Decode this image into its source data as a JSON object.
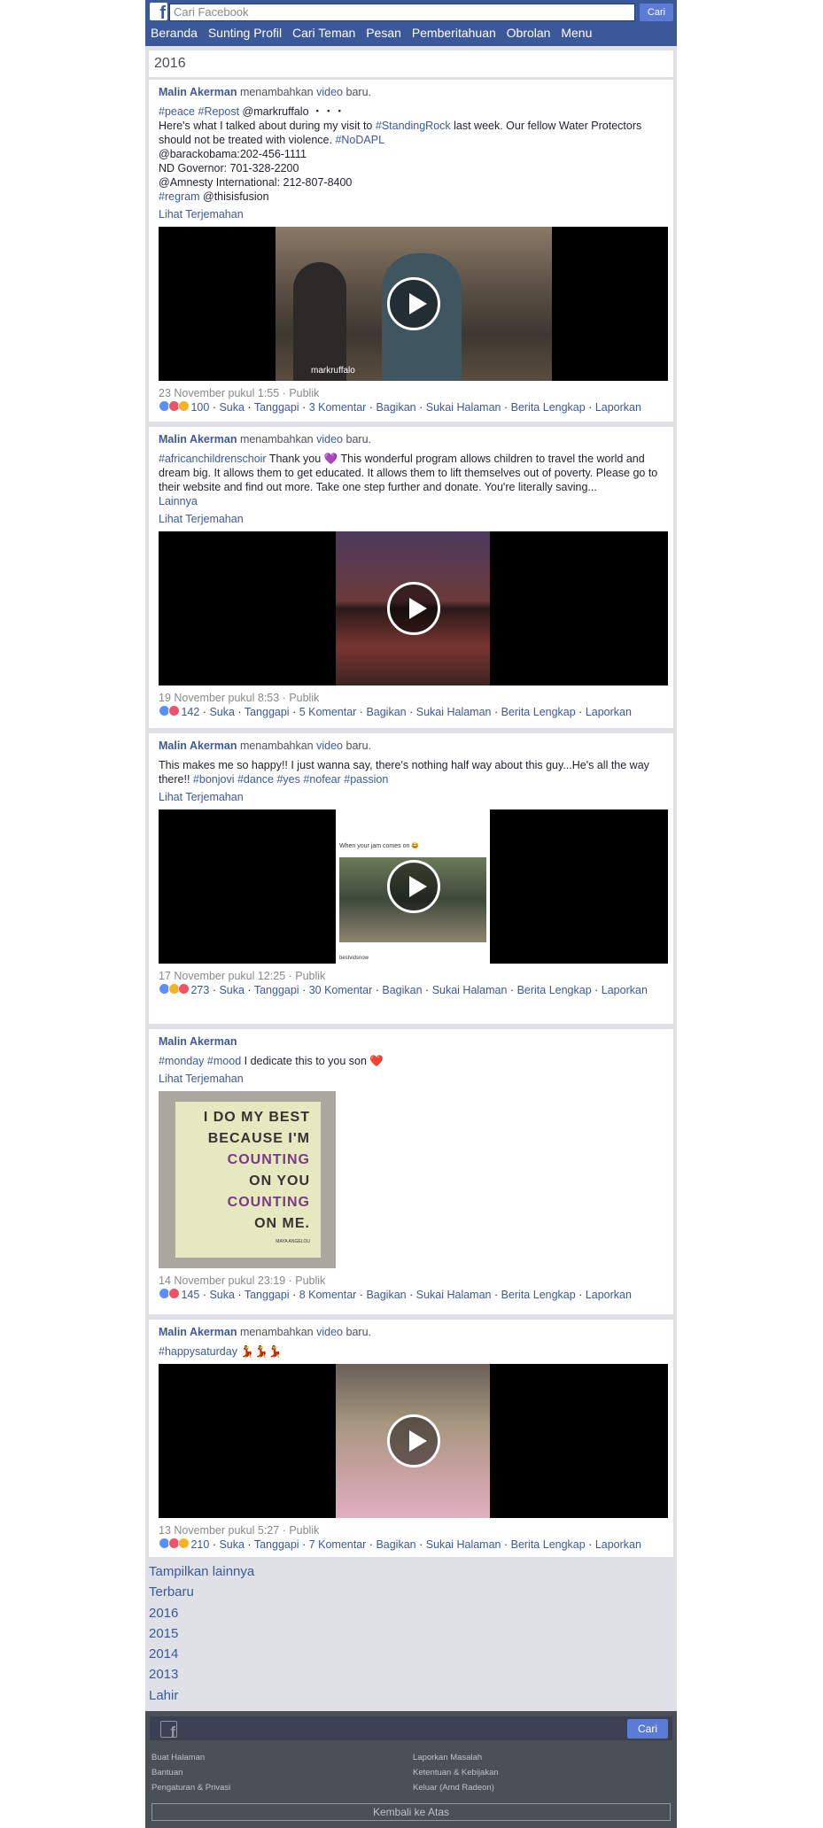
{
  "header": {
    "search_placeholder": "Cari Facebook",
    "search_button": "Cari",
    "nav": [
      "Beranda",
      "Sunting Profil",
      "Cari Teman",
      "Pesan",
      "Pemberitahuan",
      "Obrolan",
      "Menu"
    ]
  },
  "year_heading": "2016",
  "posts": [
    {
      "author": "Malin Akerman",
      "action": "menambahkan",
      "action_link": "video",
      "action_suffix": "baru.",
      "lines": [
        [
          "#peace",
          " ",
          "#Repost",
          " @markruffalo ・・・"
        ],
        [
          "Here's what I talked about during my visit to ",
          "#StandingRock",
          " last week. Our fellow Water Protectors should not be treated with violence. ",
          "#NoDAPL"
        ],
        [
          "@barackobama:202-456-1111"
        ],
        [
          "ND Governor: 701-328-2200"
        ],
        [
          "@Amnesty International: 212-807-8400"
        ],
        [
          "#regram",
          " @thisisfusion"
        ]
      ],
      "translate": "Lihat Terjemahan",
      "video_watermark": "markruffalo",
      "date": "23 November pukul 1:55",
      "privacy": "Publik",
      "reaction_count": "100",
      "actions": [
        "Suka",
        "Tanggapi",
        "3 Komentar",
        "Bagikan",
        "Sukai Halaman",
        "Berita Lengkap",
        "Laporkan"
      ]
    },
    {
      "author": "Malin Akerman",
      "action": "menambahkan",
      "action_link": "video",
      "action_suffix": "baru.",
      "text_parts": [
        "#africanchildrenschoir",
        " Thank you 💜 This wonderful program allows children to travel the world and dream big. It allows them to get educated. It allows them to lift themselves out of poverty. Please go to their website and find out more. Take one step further and donate. You're literally saving..."
      ],
      "more": "Lainnya",
      "translate": "Lihat Terjemahan",
      "date": "19 November pukul 8:53",
      "privacy": "Publik",
      "reaction_count": "142",
      "actions": [
        "Suka",
        "Tanggapi",
        "5 Komentar",
        "Bagikan",
        "Sukai Halaman",
        "Berita Lengkap",
        "Laporkan"
      ]
    },
    {
      "author": "Malin Akerman",
      "action": "menambahkan",
      "action_link": "video",
      "action_suffix": "baru.",
      "text": "This makes me so happy!! I just wanna say, there's nothing half way about this guy...He's all the way there!!",
      "hashtags": [
        "#bonjovi",
        "#dance",
        "#yes",
        "#nofear",
        "#passion"
      ],
      "translate": "Lihat Terjemahan",
      "video_caption": "When your jam comes on 😂",
      "video_watermark": "bestvidsnow",
      "date": "17 November pukul 12:25",
      "privacy": "Publik",
      "reaction_count": "273",
      "actions": [
        "Suka",
        "Tanggapi",
        "30 Komentar",
        "Bagikan",
        "Sukai Halaman",
        "Berita Lengkap",
        "Laporkan"
      ]
    },
    {
      "author": "Malin Akerman",
      "text_parts": [
        "#monday",
        " ",
        "#mood",
        " I dedicate this to you son ❤️"
      ],
      "translate": "Lihat Terjemahan",
      "image_text": [
        "I DO MY BEST",
        "BECAUSE I'M",
        "COUNTING",
        "ON YOU",
        "COUNTING",
        "ON ME."
      ],
      "image_credit": "MAYA ANGELOU",
      "date": "14 November pukul 23:19",
      "privacy": "Publik",
      "reaction_count": "145",
      "actions": [
        "Suka",
        "Tanggapi",
        "8 Komentar",
        "Bagikan",
        "Sukai Halaman",
        "Berita Lengkap",
        "Laporkan"
      ]
    },
    {
      "author": "Malin Akerman",
      "action": "menambahkan",
      "action_link": "video",
      "action_suffix": "baru.",
      "text_parts": [
        "#happysaturday",
        " 💃💃💃"
      ],
      "date": "13 November pukul 5:27",
      "privacy": "Publik",
      "reaction_count": "210",
      "actions": [
        "Suka",
        "Tanggapi",
        "7 Komentar",
        "Bagikan",
        "Sukai Halaman",
        "Berita Lengkap",
        "Laporkan"
      ]
    }
  ],
  "more_links": [
    "Tampilkan lainnya",
    "Terbaru",
    "2016",
    "2015",
    "2014",
    "2013",
    "Lahir"
  ],
  "footer": {
    "search_button": "Cari",
    "left_links": [
      "Buat Halaman",
      "Bantuan",
      "Pengaturan & Privasi"
    ],
    "right_links": [
      "Laporkan Masalah",
      "Ketentuan & Kebijakan",
      "Keluar (Amd Radeon)"
    ],
    "back_to_top": "Kembali ke Atas"
  },
  "colors": {
    "brand": "#3b5998",
    "background": "#dfe1e6",
    "footer": "#4b4f56"
  }
}
